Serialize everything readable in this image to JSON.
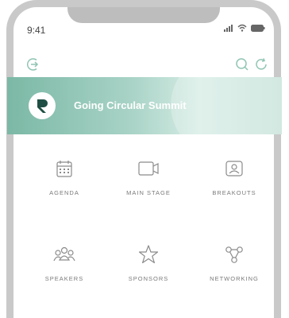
{
  "status": {
    "time": "9:41"
  },
  "banner": {
    "title": "Going Circular Summit"
  },
  "tiles": [
    {
      "label": "AGENDA"
    },
    {
      "label": "MAIN STAGE"
    },
    {
      "label": "BREAKOUTS"
    },
    {
      "label": "SPEAKERS"
    },
    {
      "label": "SPONSORS"
    },
    {
      "label": "NETWORKING"
    }
  ],
  "colors": {
    "accent": "#7bb8a5",
    "icon": "#8a8a8a"
  }
}
